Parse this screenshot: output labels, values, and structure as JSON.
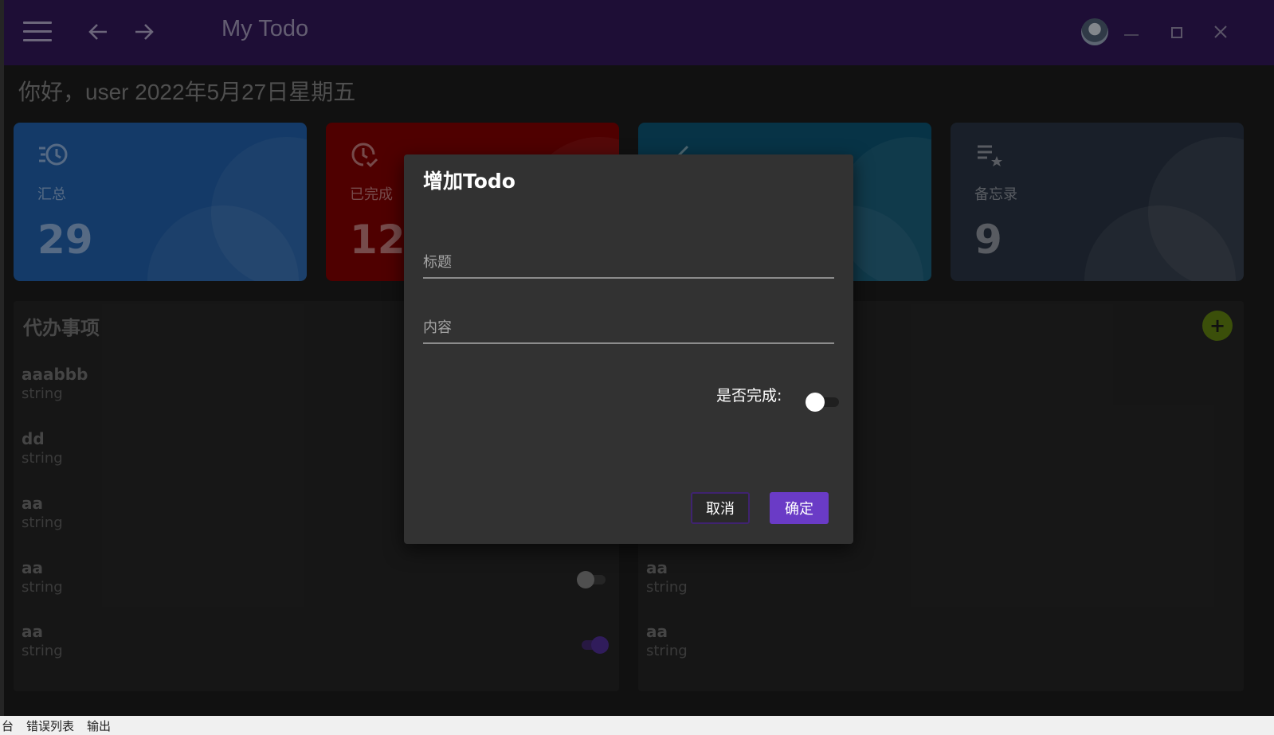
{
  "window": {
    "title": "My Todo",
    "minimize_icon": "minimize-icon",
    "maximize_icon": "maximize-icon",
    "close_icon": "close-icon",
    "accent_color": "#2e1653"
  },
  "greeting": "你好，user 2022年5月27日星期五",
  "cards": [
    {
      "label": "汇总",
      "value": "29",
      "icon": "history-icon",
      "color": "#1f5aa0"
    },
    {
      "label": "已完成",
      "value": "12",
      "icon": "clock-check-icon",
      "color": "#7a0000"
    },
    {
      "label": "",
      "value": "",
      "icon": "check-chart-icon",
      "color": "#0b4f6c"
    },
    {
      "label": "备忘录",
      "value": "9",
      "icon": "playlist-star-icon",
      "color": "#27313f"
    }
  ],
  "todo_panel": {
    "title": "代办事项",
    "items": [
      {
        "title": "aaabbb",
        "content": "string"
      },
      {
        "title": "dd",
        "content": "string"
      },
      {
        "title": "aa",
        "content": "string"
      },
      {
        "title": "aa",
        "content": "string",
        "toggle": "off"
      },
      {
        "title": "aa",
        "content": "string",
        "toggle": "on"
      }
    ]
  },
  "memo_panel": {
    "add_label": "+",
    "items": [
      {
        "title": "aa",
        "content": "string"
      },
      {
        "title": "aa",
        "content": "string"
      }
    ]
  },
  "dialog": {
    "title": "增加Todo",
    "title_placeholder": "标题",
    "content_placeholder": "内容",
    "done_label": "是否完成:",
    "done_value": false,
    "cancel_label": "取消",
    "ok_label": "确定"
  },
  "bottom_tabs": [
    "台",
    "错误列表",
    "输出"
  ]
}
